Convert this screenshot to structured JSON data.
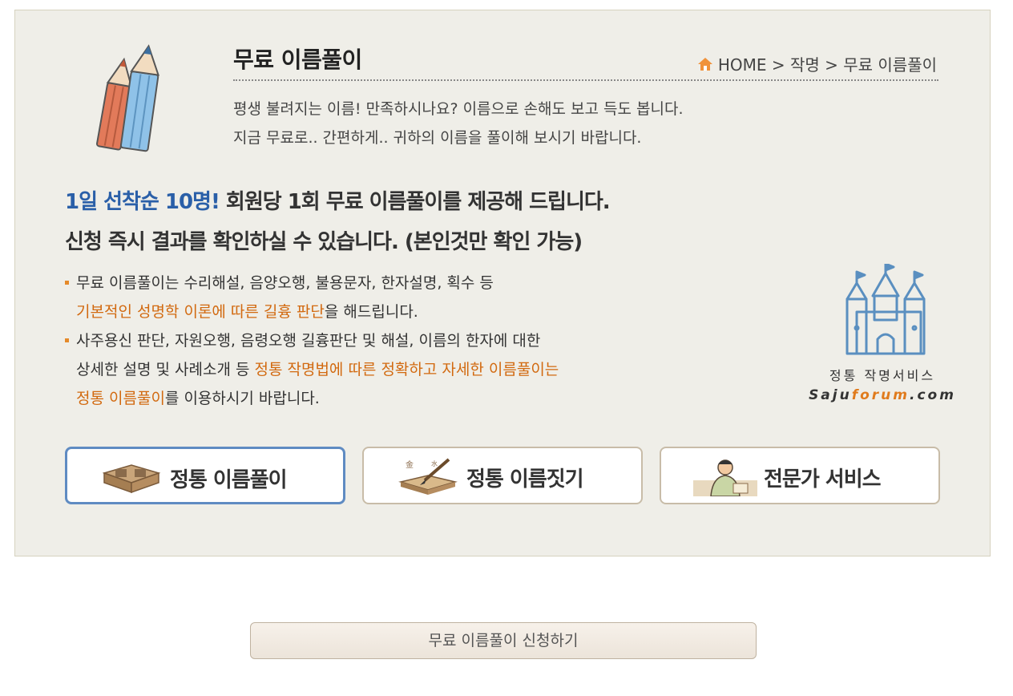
{
  "header": {
    "title": "무료 이름풀이",
    "breadcrumb": "HOME > 작명 > 무료 이름풀이",
    "intro_line1": "평생 불려지는 이름! 만족하시나요? 이름으로 손해도 보고 득도 봅니다.",
    "intro_line2": "지금 무료로.. 간편하게.. 귀하의 이름을 풀이해 보시기 바랍니다."
  },
  "headline": {
    "accent": "1일 선착순 10명!",
    "line1_rest": " 회원당 1회 무료 이름풀이를 제공해 드립니다.",
    "line2": "신청 즉시 결과를 확인하실 수 있습니다. (본인것만 확인 가능)"
  },
  "bullets": {
    "b1_line1": "무료 이름풀이는 수리해설, 음양오행, 불용문자, 한자설명, 획수 등",
    "b1_line2_highlight": "기본적인 성명학 이론에 따른 길흉 판단",
    "b1_line2_rest": "을 해드립니다.",
    "b2_line1": "사주용신 판단, 자원오행, 음령오행 길흉판단 및 해설, 이름의 한자에 대한",
    "b2_line2_text": "상세한 설명 및 사례소개 등 ",
    "b2_line2_highlight": "정통 작명법에 따른 정확하고 자세한 이름풀이는",
    "b2_line3_highlight": "정통 이름풀이",
    "b2_line3_rest": "를 이용하시기 바랍니다."
  },
  "logo": {
    "caption": "정통 작명서비스",
    "site_pre": "Saju",
    "site_accent": "forum",
    "site_post": ".com"
  },
  "services": [
    {
      "label": "정통 이름풀이",
      "icon": "name-book-icon"
    },
    {
      "label": "정통 이름짓기",
      "icon": "brush-book-icon"
    },
    {
      "label": "전문가 서비스",
      "icon": "expert-person-icon"
    }
  ],
  "apply_button": "무료 이름풀이 신청하기",
  "colors": {
    "accent_blue": "#2a5fa8",
    "highlight_orange": "#d2690f",
    "bullet_orange": "#e58a2a",
    "active_border": "#5f8bc2"
  }
}
